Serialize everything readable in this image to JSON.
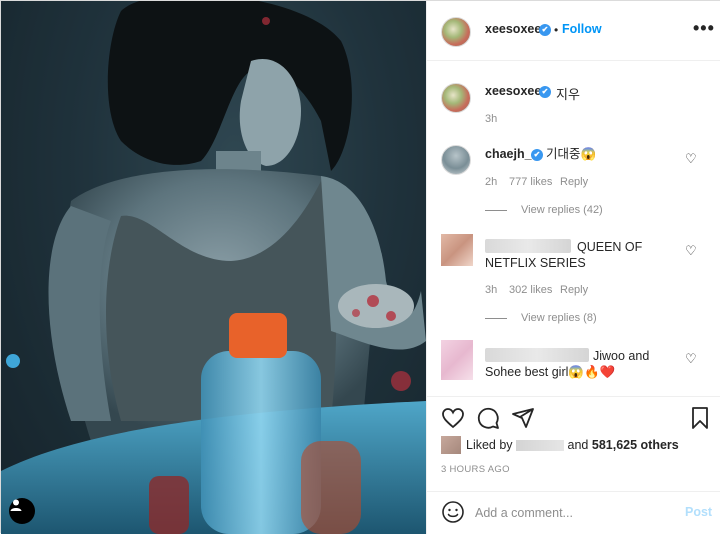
{
  "post": {
    "author": "xeesoxee",
    "follow_label": "Follow",
    "separator": "•",
    "more_label": "•••",
    "verified_mark": "✔"
  },
  "caption": {
    "username": "xeesoxee",
    "text": "지우",
    "time": "3h"
  },
  "comments": [
    {
      "username": "chaejh_",
      "text": "기대중😱",
      "time": "2h",
      "likes": "777 likes",
      "reply_label": "Reply",
      "view_replies": "View replies (42)"
    },
    {
      "username": "",
      "text_line1": "QUEEN OF",
      "text_line2": "NETFLIX SERIES",
      "time": "3h",
      "likes": "302 likes",
      "reply_label": "Reply",
      "view_replies": "View replies (8)"
    },
    {
      "username": "",
      "text_line1": "Jiwoo and",
      "text_line2": "Sohee best girl😱🔥❤️"
    }
  ],
  "actions": {
    "liked_by_prefix": "Liked by",
    "liked_by_and": "and",
    "others": "581,625 others",
    "post_time": "3 HOURS AGO"
  },
  "comment_box": {
    "placeholder": "Add a comment...",
    "post_label": "Post"
  },
  "icons": {
    "like": "heart-icon",
    "comment": "comment-icon",
    "share": "share-icon",
    "save": "bookmark-icon",
    "emoji": "emoji-icon",
    "user_tag": "user-tag-icon"
  },
  "colors": {
    "accent": "#0095f6",
    "verified": "#3897f0",
    "muted": "#8e8e8e",
    "heart_red": "#ed4956"
  }
}
